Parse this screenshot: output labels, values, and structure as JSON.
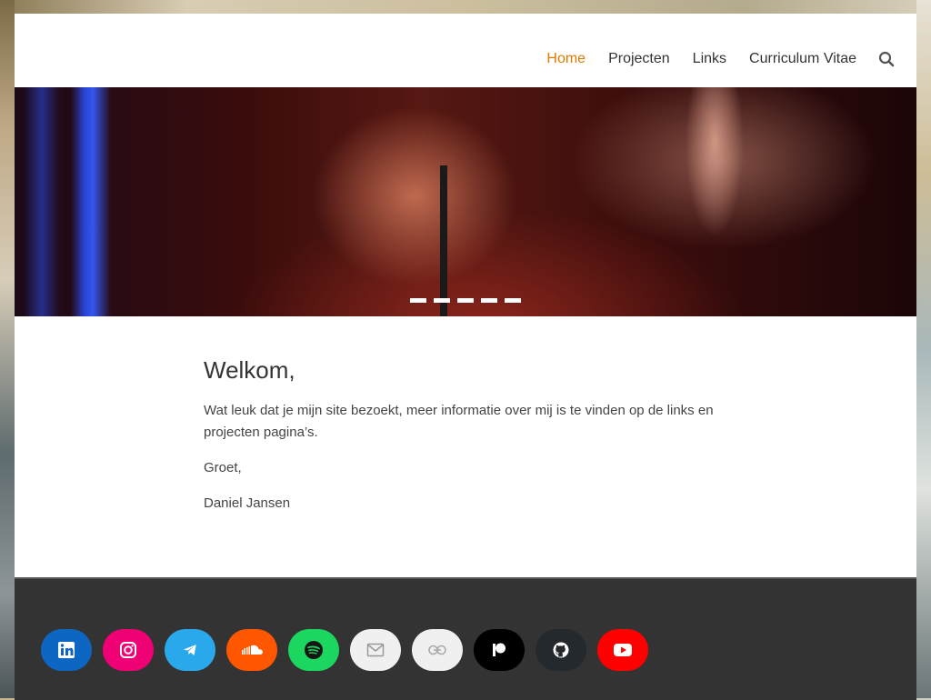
{
  "nav": {
    "items": [
      {
        "label": "Home",
        "active": true
      },
      {
        "label": "Projecten",
        "active": false
      },
      {
        "label": "Links",
        "active": false
      },
      {
        "label": "Curriculum Vitae",
        "active": false
      }
    ],
    "search_icon": "search-icon",
    "accent_color": "#e07b00"
  },
  "hero": {
    "slide_count": 5,
    "active_slide": 1
  },
  "main": {
    "title": "Welkom,",
    "intro": "Wat leuk dat je mijn site bezoekt, meer informatie over mij is te vinden op de links en projecten pagina’s.",
    "greeting": "Groet,",
    "signature": "Daniel Jansen"
  },
  "footer": {
    "social": [
      {
        "name": "linkedin",
        "icon": "linkedin-icon",
        "color": "#0d66c2"
      },
      {
        "name": "instagram",
        "icon": "instagram-icon",
        "color": "#f00075"
      },
      {
        "name": "telegram",
        "icon": "telegram-icon",
        "color": "#29a9eb"
      },
      {
        "name": "soundcloud",
        "icon": "soundcloud-icon",
        "color": "#ff5600"
      },
      {
        "name": "spotify",
        "icon": "spotify-icon",
        "color": "#1bd760"
      },
      {
        "name": "mail",
        "icon": "mail-icon",
        "color": "#f0f0f0"
      },
      {
        "name": "link",
        "icon": "link-icon",
        "color": "#f0f0f0"
      },
      {
        "name": "patreon",
        "icon": "patreon-icon",
        "color": "#000000"
      },
      {
        "name": "github",
        "icon": "github-icon",
        "color": "#24292d"
      },
      {
        "name": "youtube",
        "icon": "youtube-icon",
        "color": "#ff0000"
      }
    ]
  }
}
